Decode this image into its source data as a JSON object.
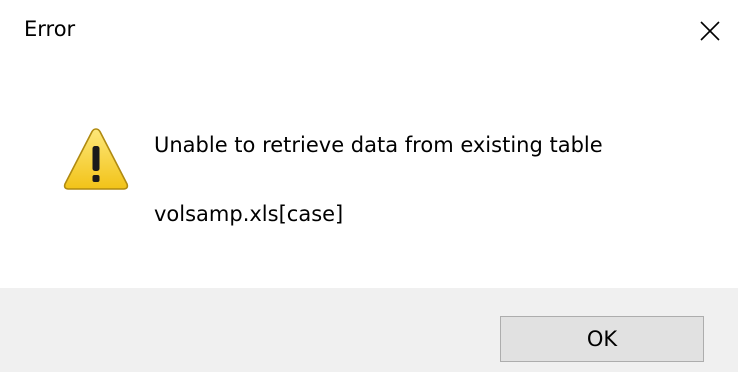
{
  "window": {
    "title": "Error",
    "close_icon": "close-icon"
  },
  "message": {
    "icon": "warning-icon",
    "line1": "Unable to retrieve data from existing table",
    "line2": "volsamp.xls[case]"
  },
  "buttons": {
    "ok_label": "OK"
  },
  "colors": {
    "footer_background": "#f0f0f0",
    "button_face": "#e1e1e1",
    "button_border": "#adadad",
    "warning_yellow": "#f8d63c"
  }
}
